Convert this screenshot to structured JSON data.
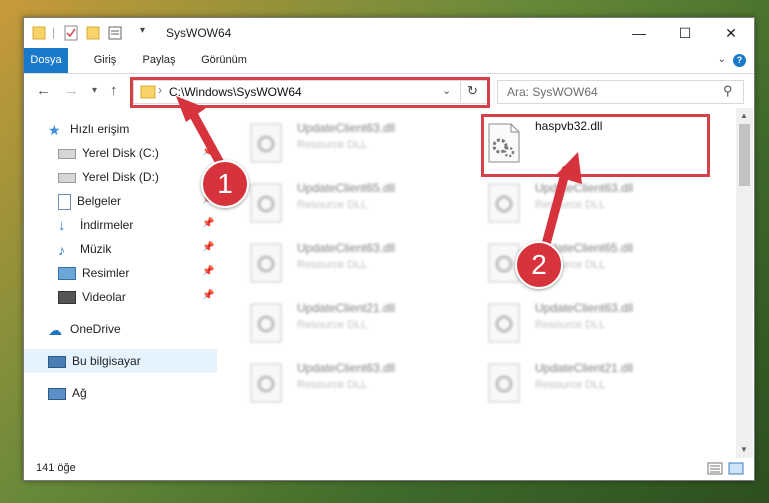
{
  "window": {
    "title": "SysWOW64",
    "controls": {
      "minimize": "—",
      "maximize": "☐",
      "close": "✕"
    }
  },
  "ribbon": {
    "tabs": [
      "Dosya",
      "Giriş",
      "Paylaş",
      "Görünüm"
    ],
    "help": "?"
  },
  "address": {
    "path": "C:\\Windows\\SysWOW64",
    "search_placeholder": "Ara: SysWOW64"
  },
  "sidebar": {
    "quick_access": "Hızlı erişim",
    "items": [
      {
        "label": "Yerel Disk (C:)",
        "pinned": true
      },
      {
        "label": "Yerel Disk (D:)",
        "pinned": true
      },
      {
        "label": "Belgeler",
        "pinned": true
      },
      {
        "label": "İndirmeler",
        "pinned": true
      },
      {
        "label": "Müzik",
        "pinned": true
      },
      {
        "label": "Resimler",
        "pinned": true
      },
      {
        "label": "Videolar",
        "pinned": true
      }
    ],
    "onedrive": "OneDrive",
    "this_pc": "Bu bilgisayar",
    "network": "Ağ"
  },
  "files": {
    "left_column": [
      {
        "name": "UpdateClient63.dll",
        "desc": "Resource DLL"
      },
      {
        "name": "UpdateClient65.dll",
        "desc": "Resource DLL"
      },
      {
        "name": "UpdateClient63.dll",
        "desc": "Resource DLL"
      },
      {
        "name": "UpdateClient21.dll",
        "desc": "Resource DLL"
      },
      {
        "name": "UpdateClient63.dll",
        "desc": "Resource DLL"
      }
    ],
    "highlighted": {
      "name": "haspvb32.dll"
    },
    "right_column": [
      {
        "name": "UpdateClient63.dll",
        "desc": "Resource DLL"
      },
      {
        "name": "UpdateClient65.dll",
        "desc": "Resource DLL"
      },
      {
        "name": "UpdateClient63.dll",
        "desc": "Resource DLL"
      },
      {
        "name": "UpdateClient21.dll",
        "desc": "Resource DLL"
      }
    ]
  },
  "status": {
    "count": "141 öğe"
  },
  "callouts": [
    "1",
    "2"
  ],
  "colors": {
    "accent": "#1979ca",
    "highlight": "#d4414a",
    "callout": "#d6333c"
  }
}
